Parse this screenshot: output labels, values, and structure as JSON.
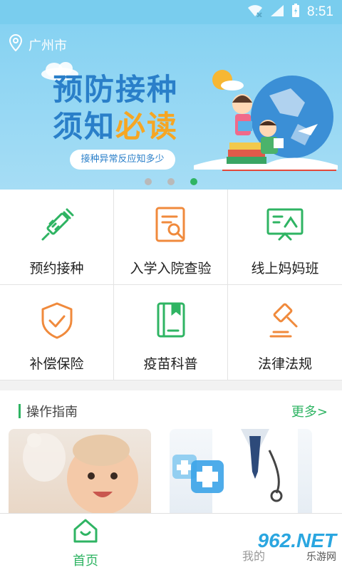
{
  "status_bar": {
    "time": "8:51"
  },
  "banner": {
    "location": "广州市",
    "headline_line1": "预防接种",
    "headline_line2a": "须知",
    "headline_line2b": "必读",
    "pill_text": "接种异常反应知多少",
    "active_dot": 3,
    "dot_count": 3
  },
  "grid": {
    "items": [
      {
        "label": "预约接种",
        "icon": "syringe-icon",
        "color": "#2fb463"
      },
      {
        "label": "入学入院查验",
        "icon": "document-search-icon",
        "color": "#f08a3c"
      },
      {
        "label": "线上妈妈班",
        "icon": "presentation-board-icon",
        "color": "#2fb463"
      },
      {
        "label": "补偿保险",
        "icon": "shield-check-icon",
        "color": "#f08a3c"
      },
      {
        "label": "疫苗科普",
        "icon": "book-icon",
        "color": "#2fb463"
      },
      {
        "label": "法律法规",
        "icon": "gavel-icon",
        "color": "#f08a3c"
      }
    ]
  },
  "guide": {
    "title": "操作指南",
    "more": "更多>"
  },
  "tabbar": {
    "home_label": "首页",
    "partial_label": "我的"
  },
  "watermark": {
    "brand": "962.NET",
    "sub": "乐游网"
  },
  "colors": {
    "accent": "#2fb463",
    "orange": "#f08a3c",
    "banner_blue": "#86d2f2"
  }
}
